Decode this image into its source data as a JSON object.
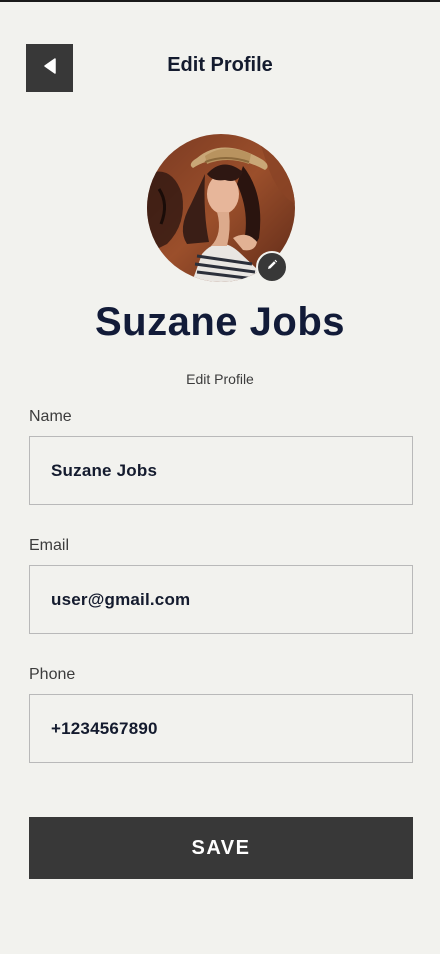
{
  "header": {
    "title": "Edit Profile",
    "back_icon": "back-arrow-icon"
  },
  "profile": {
    "name": "Suzane Jobs",
    "subtitle": "Edit Profile",
    "edit_icon": "pencil-icon"
  },
  "form": {
    "fields": [
      {
        "label": "Name",
        "value": "Suzane Jobs"
      },
      {
        "label": "Email",
        "value": "user@gmail.com"
      },
      {
        "label": "Phone",
        "value": "+1234567890"
      }
    ],
    "save_label": "SAVE"
  },
  "colors": {
    "background": "#f2f2ee",
    "button": "#383838",
    "text_dark": "#141b2e"
  }
}
